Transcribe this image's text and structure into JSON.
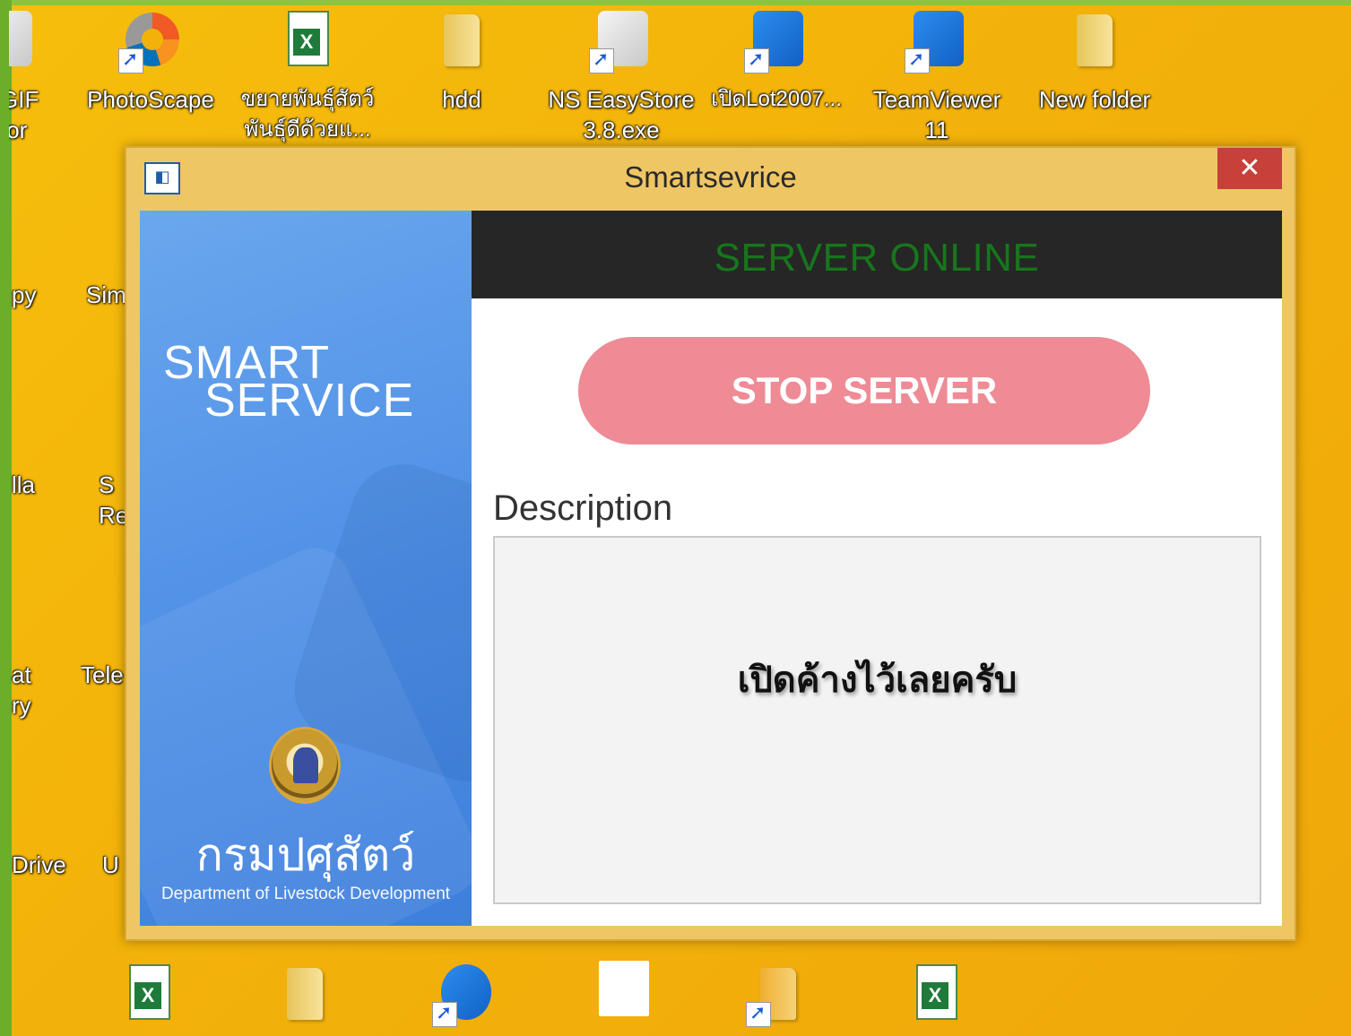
{
  "desktop": {
    "top_icons": [
      {
        "label": "GIF\ntor",
        "icon": "app-icon"
      },
      {
        "label": "PhotoScape",
        "icon": "photoscape-icon"
      },
      {
        "label": "ขยายพันธุ์สัตว์\nพันธุ์ดีด้วยแ...",
        "icon": "excel-file-icon"
      },
      {
        "label": "hdd",
        "icon": "folder-icon"
      },
      {
        "label": "NS EasyStore\n3.8.exe",
        "icon": "easystore-icon"
      },
      {
        "label": "เปิดLot2007...",
        "icon": "compass-icon"
      },
      {
        "label": "TeamViewer\n11",
        "icon": "teamviewer-icon"
      },
      {
        "label": "New folder",
        "icon": "folder-icon"
      }
    ],
    "left_icons": [
      {
        "label": "py"
      },
      {
        "label": "Sim"
      },
      {
        "label": "lla"
      },
      {
        "label": "S\nRe"
      },
      {
        "label": "at\nry"
      },
      {
        "label": "Tele"
      },
      {
        "label": "Drive"
      },
      {
        "label": "U"
      }
    ],
    "bottom_icons": [
      "excel-file-icon",
      "folder-icon",
      "chat-icon",
      "document-icon",
      "shortcut-icon",
      "excel-file-icon"
    ]
  },
  "window": {
    "title": "Smartsevrice",
    "close_glyph": "✕",
    "app_icon_glyph": "◧"
  },
  "sidebar": {
    "brand_line1": "SMART",
    "brand_line2": "SERVICE",
    "dept_thai": "กรมปศุสัตว์",
    "dept_english": "Department of Livestock Development"
  },
  "status": {
    "text": "SERVER ONLINE",
    "color": "#17761c"
  },
  "actions": {
    "stop_label": "STOP SERVER",
    "stop_color": "#ee8b95"
  },
  "description": {
    "label": "Description",
    "value": "เปิดค้างไว้เลยครับ"
  }
}
